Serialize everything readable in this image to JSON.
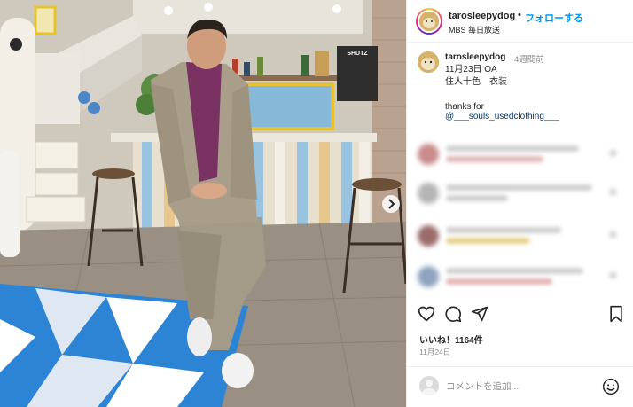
{
  "post": {
    "username": "tarosleepydog",
    "follow_label": "フォローする",
    "separator": "•",
    "subtitle": "MBS 毎日放送"
  },
  "caption": {
    "username": "tarosleepydog",
    "time_ago": "4週間前",
    "lines": [
      "11月23日 OA",
      "住人十色　衣装",
      "",
      "thanks for"
    ],
    "mention": "@___souls_usedclothing___"
  },
  "actions": {
    "like_icon": "heart-icon",
    "comment_icon": "comment-icon",
    "share_icon": "share-icon",
    "save_icon": "bookmark-icon"
  },
  "stats": {
    "likes": "いいね！1164件",
    "date": "11月24日"
  },
  "comment_box": {
    "placeholder": "コメントを追加...",
    "emoji_icon": "emoji-icon"
  },
  "photo": {
    "sign_text": "SHUTZ"
  },
  "colors": {
    "link_blue": "#0095f6",
    "mention_blue": "#00376b",
    "muted_gray": "#8e8e8e"
  }
}
